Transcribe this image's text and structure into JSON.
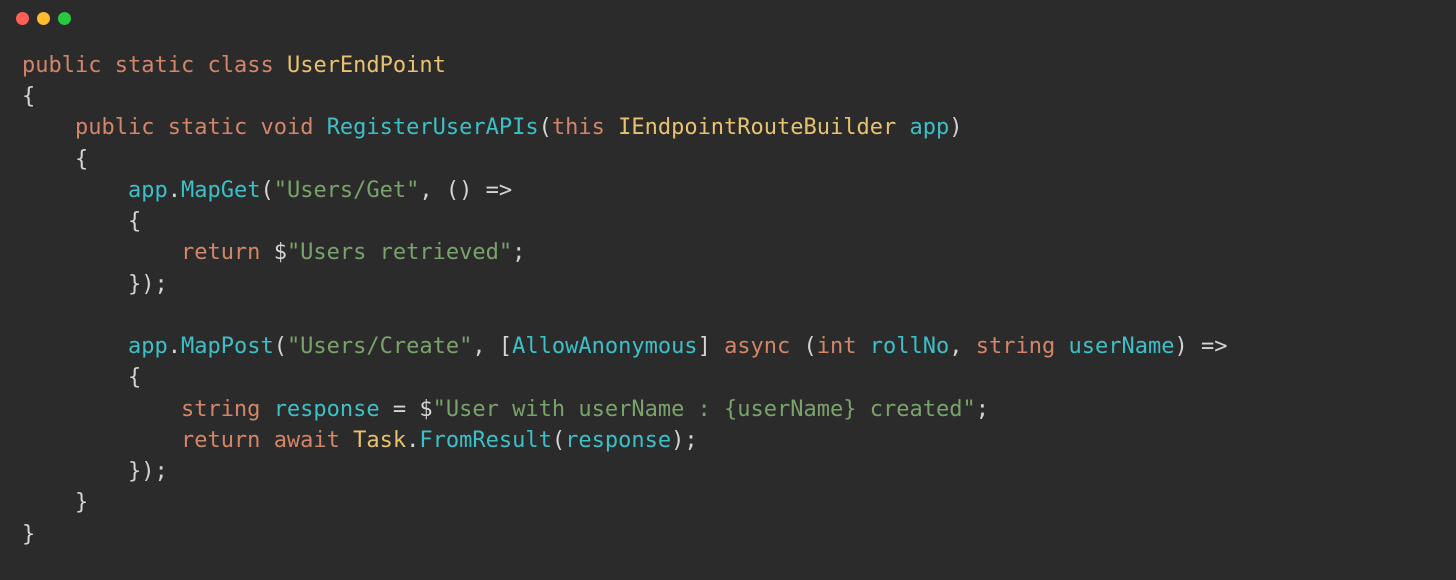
{
  "titlebar": {
    "close_label": "close",
    "minimize_label": "minimize",
    "maximize_label": "maximize"
  },
  "code": {
    "l1_public": "public",
    "l1_static": "static",
    "l1_class": "class",
    "l1_name": "UserEndPoint",
    "l2_brace": "{",
    "l3_public": "public",
    "l3_static": "static",
    "l3_void": "void",
    "l3_fn": "RegisterUserAPIs",
    "l3_this": "this",
    "l3_type": "IEndpointRouteBuilder",
    "l3_param": "app",
    "l4_brace": "{",
    "l5_app": "app",
    "l5_mapget": "MapGet",
    "l5_route": "\"Users/Get\"",
    "l5_lambda": "() =>",
    "l6_brace": "{",
    "l7_return": "return",
    "l7_dollar": "$",
    "l7_str": "\"Users retrieved\"",
    "l8_close": "});",
    "l10_app": "app",
    "l10_mappost": "MapPost",
    "l10_route": "\"Users/Create\"",
    "l10_attr": "AllowAnonymous",
    "l10_async": "async",
    "l10_int": "int",
    "l10_rollno": "rollNo",
    "l10_string": "string",
    "l10_username": "userName",
    "l10_arrow": ") =>",
    "l11_brace": "{",
    "l12_string": "string",
    "l12_response": "response",
    "l12_eq": " = ",
    "l12_dollar": "$",
    "l12_str": "\"User with userName : {userName} created\"",
    "l13_return": "return",
    "l13_await": "await",
    "l13_task": "Task",
    "l13_fromresult": "FromResult",
    "l13_response": "response",
    "l14_close": "});",
    "l15_brace": "}",
    "l16_brace": "}"
  }
}
